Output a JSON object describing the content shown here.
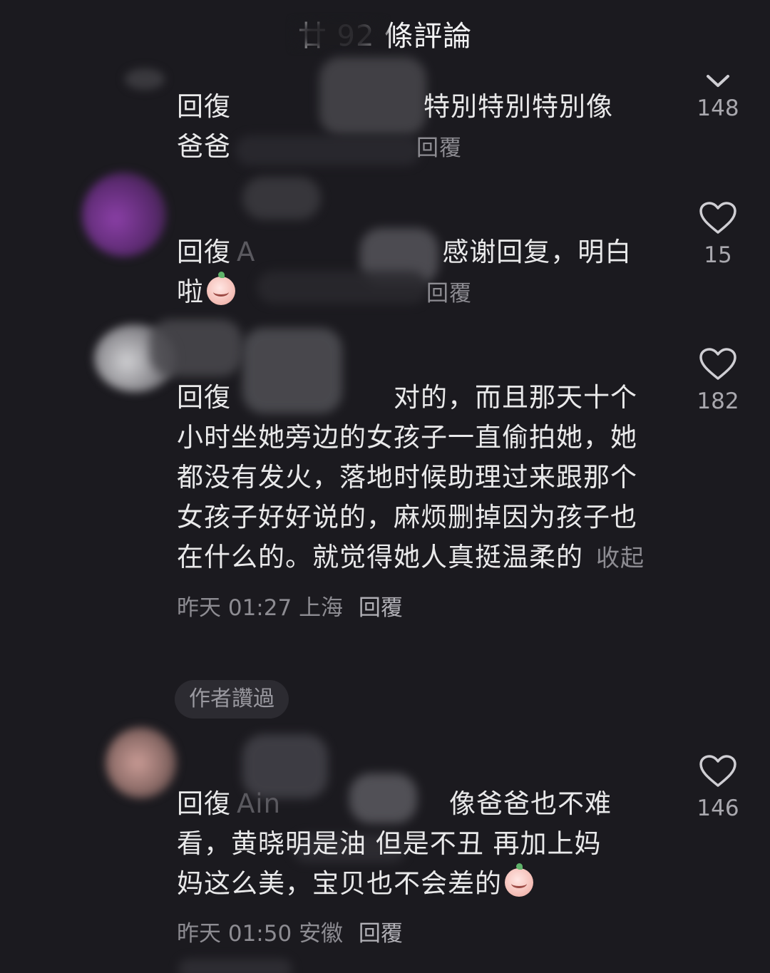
{
  "header": {
    "title": "廿 92 條評論"
  },
  "comments": [
    {
      "reply_prefix": "回復",
      "text_line1": "特別特別特別像",
      "text_line2_start": "爸爸",
      "reply_label": "回覆",
      "like_count": "148"
    },
    {
      "reply_prefix": "回復",
      "reply_to_partial": "A",
      "text_line1": "感谢回复，明白",
      "text_line2": "啦",
      "emoji_name": "baby-face-emoji",
      "reply_label": "回覆",
      "like_count": "15"
    },
    {
      "reply_prefix": "回復",
      "text": "对的，而且那天十个小时坐她旁边的女孩子一直偷拍她，她都没有发火，落地时候助理过来跟那个女孩子好好说的，麻烦删掉因为孩子也在什么的。就觉得她人真挺温柔的",
      "collapse_label": "收起",
      "time": "昨天 01:27",
      "location": "上海",
      "reply_label": "回覆",
      "author_liked": "作者讚過",
      "like_count": "182"
    },
    {
      "reply_prefix": "回復",
      "reply_to_partial": "Ain",
      "text_line1": "像爸爸也不难",
      "text_line2": "看，黄晓明是油 但是不丑 再加上妈",
      "text_line3": "妈这么美，宝贝也不会差的",
      "emoji_name": "baby-face-emoji",
      "time": "昨天 01:50",
      "location": "安徽",
      "reply_label": "回覆",
      "like_count": "146"
    }
  ],
  "colors": {
    "background": "#1b1a1f",
    "text": "#e9e9ea",
    "meta": "#8d8c92"
  }
}
